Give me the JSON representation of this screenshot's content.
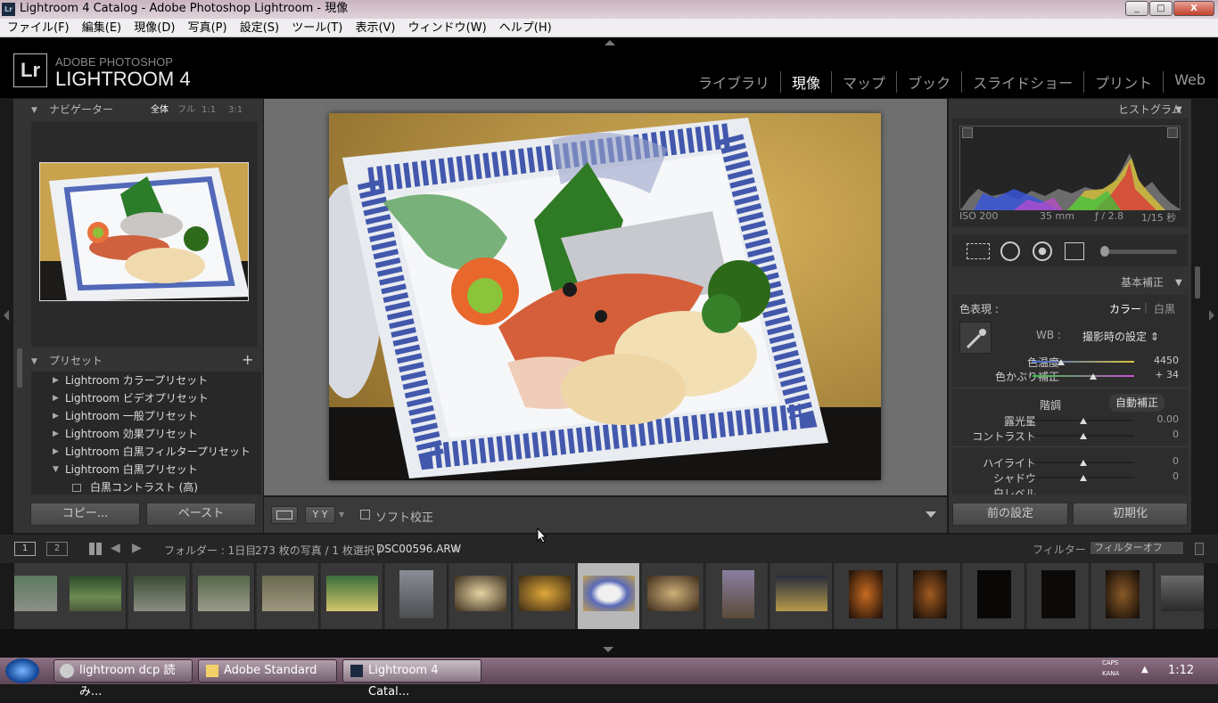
{
  "window": {
    "title": "Lightroom 4 Catalog - Adobe Photoshop Lightroom - 現像",
    "app_icon": "Lr",
    "min": "_",
    "max": "□",
    "close": "X"
  },
  "menu": [
    "ファイル(F)",
    "編集(E)",
    "現像(D)",
    "写真(P)",
    "設定(S)",
    "ツール(T)",
    "表示(V)",
    "ウィンドウ(W)",
    "ヘルプ(H)"
  ],
  "brand": {
    "logo": "Lr",
    "line1": "ADOBE PHOTOSHOP",
    "line2": "LIGHTROOM 4"
  },
  "modules": [
    "ライブラリ",
    "現像",
    "マップ",
    "ブック",
    "スライドショー",
    "プリント",
    "Web"
  ],
  "navigator": {
    "title": "ナビゲーター",
    "zoom": [
      "全体",
      "フル",
      "1:1",
      "3:1"
    ]
  },
  "presets": {
    "title": "プリセット",
    "add": "+",
    "items": [
      {
        "label": "Lightroom カラープリセット",
        "tri": "▶"
      },
      {
        "label": "Lightroom ビデオプリセット",
        "tri": "▶"
      },
      {
        "label": "Lightroom 一般プリセット",
        "tri": "▶"
      },
      {
        "label": "Lightroom 効果プリセット",
        "tri": "▶"
      },
      {
        "label": "Lightroom 白黒フィルタープリセット",
        "tri": "▶"
      },
      {
        "label": "Lightroom 白黒プリセット",
        "tri": "▼"
      },
      {
        "label": "白黒コントラスト (高)",
        "tri": ""
      }
    ]
  },
  "left_buttons": {
    "copy": "コピー...",
    "paste": "ペースト"
  },
  "toolbar": {
    "soft_proof": "ソフト校正",
    "yy": "Y Y"
  },
  "histogram": {
    "title": "ヒストグラム",
    "iso": "ISO 200",
    "focal": "35 mm",
    "aperture": "ƒ / 2.8",
    "shutter": "1/15 秒"
  },
  "basic": {
    "title": "基本補正",
    "treatment_label": "色表現 :",
    "color": "カラー",
    "bw": "白黒",
    "wb_label": "WB :",
    "wb_value": "撮影時の設定 ⇕",
    "temp_label": "色温度",
    "temp_value": "4450",
    "temp_pos": 0.28,
    "tint_label": "色かぶり補正",
    "tint_value": "+ 34",
    "tint_pos": 0.6,
    "tone_label": "階調",
    "auto_label": "自動補正",
    "exposure_label": "露光量",
    "exposure_value": "0.00",
    "exposure_pos": 0.5,
    "contrast_label": "コントラスト",
    "contrast_value": "0",
    "contrast_pos": 0.5,
    "highlights_label": "ハイライト",
    "highlights_value": "0",
    "highlights_pos": 0.5,
    "shadows_label": "シャドウ",
    "shadows_value": "0",
    "shadows_pos": 0.5,
    "whites_label": "白レベル"
  },
  "right_buttons": {
    "previous": "前の設定",
    "reset": "初期化"
  },
  "filmbar": {
    "view1": "1",
    "view2": "2",
    "source": "フォルダー : 1日目",
    "count": "273 枚の写真 / 1 枚選択 /",
    "filename": "DSC00596.ARW",
    "filter_label": "フィルター :",
    "filter_value": "フィルターオフ"
  },
  "taskbar": {
    "tasks": [
      "lightroom dcp 読み...",
      "Adobe Standard",
      "Lightroom 4 Catal..."
    ],
    "caps": "CAPS",
    "kana": "KANA",
    "clock": "1:12"
  },
  "colors": {
    "accent": "#d8d8d8",
    "panel": "#333333",
    "bg": "#1a1a1a"
  }
}
